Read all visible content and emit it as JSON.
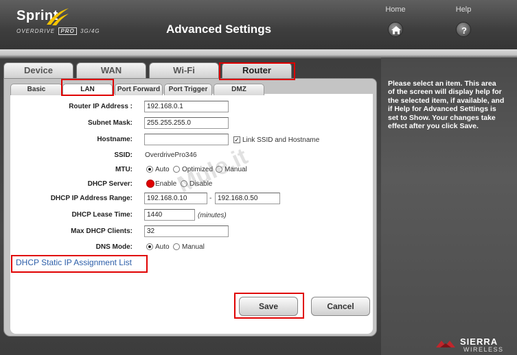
{
  "header": {
    "brand": "Sprint",
    "product": "OVERDRIVE",
    "product_tag": "PRO",
    "product_suffix": "3G/4G",
    "title": "Advanced Settings",
    "home_label": "Home",
    "help_label": "Help"
  },
  "main_tabs": [
    {
      "label": "Device"
    },
    {
      "label": "WAN"
    },
    {
      "label": "Wi-Fi"
    },
    {
      "label": "Router"
    }
  ],
  "sub_tabs": [
    {
      "label": "Basic"
    },
    {
      "label": "LAN"
    },
    {
      "label": "Port Forward"
    },
    {
      "label": "Port Trigger"
    },
    {
      "label": "DMZ"
    }
  ],
  "form": {
    "router_ip": {
      "label": "Router IP Address :",
      "value": "192.168.0.1"
    },
    "subnet": {
      "label": "Subnet Mask:",
      "value": "255.255.255.0"
    },
    "hostname": {
      "label": "Hostname:",
      "value": "",
      "link_label": "Link SSID and Hostname",
      "link_checked": true
    },
    "ssid": {
      "label": "SSID:",
      "value": "OverdrivePro346"
    },
    "mtu": {
      "label": "MTU:",
      "options": [
        "Auto",
        "Optimized",
        "Manual"
      ],
      "selected": "Auto"
    },
    "dhcp_server": {
      "label": "DHCP Server:",
      "options": [
        "Enable",
        "Disable"
      ],
      "selected": "Enable"
    },
    "dhcp_range": {
      "label": "DHCP IP Address Range:",
      "start": "192.168.0.10",
      "separator": "-",
      "end": "192.168.0.50"
    },
    "lease": {
      "label": "DHCP Lease Time:",
      "value": "1440",
      "unit": "(minutes)"
    },
    "max_clients": {
      "label": "Max DHCP Clients:",
      "value": "32"
    },
    "dns_mode": {
      "label": "DNS Mode:",
      "options": [
        "Auto",
        "Manual"
      ],
      "selected": "Auto"
    }
  },
  "static_link": "DHCP Static IP Assignment List",
  "buttons": {
    "save": "Save",
    "cancel": "Cancel"
  },
  "help_text": "Please select an item. This area of the screen will display help for the selected item, if available, and if Help for Advanced Settings is set to Show. Your changes take effect after you click Save.",
  "watermark": "Mule.it",
  "footer": {
    "brand": "SIERRA",
    "brand_sub": "WIRELESS"
  },
  "colors": {
    "highlight": "#e00000",
    "link": "#2c5da8"
  }
}
